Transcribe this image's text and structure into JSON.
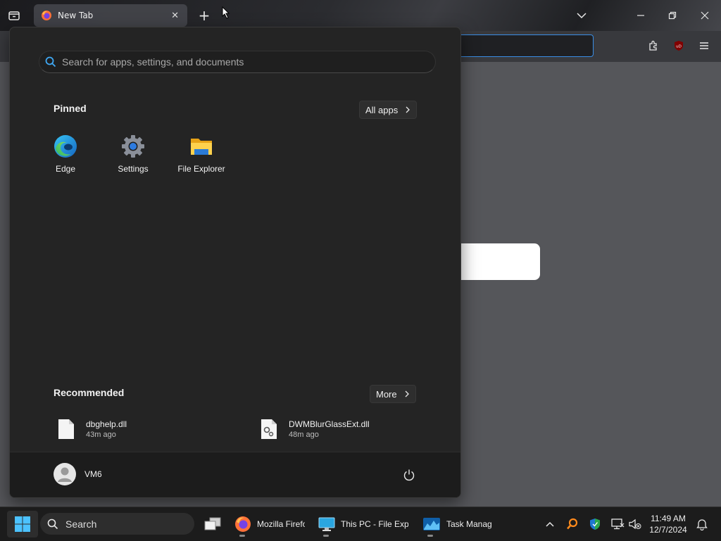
{
  "browser": {
    "tab_title": "New Tab",
    "tab_close": "✕",
    "new_tab": "+"
  },
  "start_menu": {
    "search": {
      "placeholder": "Search for apps, settings, and documents"
    },
    "pinned": {
      "title": "Pinned",
      "all_apps_label": "All apps",
      "apps": [
        {
          "label": "Edge"
        },
        {
          "label": "Settings"
        },
        {
          "label": "File Explorer"
        }
      ]
    },
    "recommended": {
      "title": "Recommended",
      "more_label": "More",
      "items": [
        {
          "name": "dbghelp.dll",
          "time": "43m ago"
        },
        {
          "name": "DWMBlurGlassExt.dll",
          "time": "48m ago"
        }
      ]
    },
    "user": {
      "name": "VM6"
    }
  },
  "taskbar": {
    "search_label": "Search",
    "apps": [
      {
        "label": "Mozilla Firefox"
      },
      {
        "label": "This PC - File Explorer"
      },
      {
        "label": "Task Manager"
      }
    ],
    "clock": {
      "time": "11:49 AM",
      "date": "12/7/2024"
    }
  },
  "colors": {
    "accent_blue": "#3a8ee6",
    "menu_bg": "#242424",
    "taskbar_bg": "#1c1c1c"
  }
}
